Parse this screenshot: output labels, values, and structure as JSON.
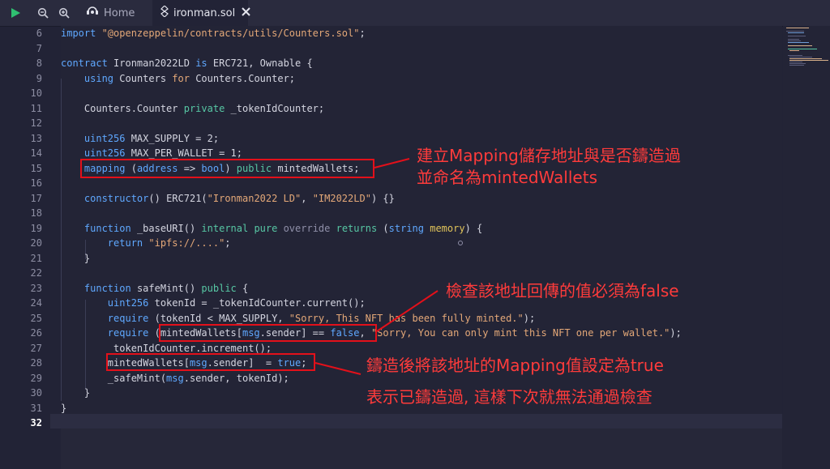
{
  "toolbar": {
    "run_icon": "play-icon",
    "zoom_out_icon": "zoom-out-icon",
    "zoom_in_icon": "zoom-in-icon",
    "tabs": [
      {
        "label": "Home",
        "icon": "remix-logo-icon"
      },
      {
        "label": "ironman.sol",
        "icon": "solidity-file-icon"
      }
    ]
  },
  "editor": {
    "file": "ironman.sol",
    "current_line": "32",
    "lines": [
      {
        "n": "6",
        "text": "import \"@openzeppelin/contracts/utils/Counters.sol\";"
      },
      {
        "n": "7",
        "text": ""
      },
      {
        "n": "8",
        "text": "contract Ironman2022LD is ERC721, Ownable {"
      },
      {
        "n": "9",
        "text": "    using Counters for Counters.Counter;"
      },
      {
        "n": "10",
        "text": ""
      },
      {
        "n": "11",
        "text": "    Counters.Counter private _tokenIdCounter;"
      },
      {
        "n": "12",
        "text": ""
      },
      {
        "n": "13",
        "text": "    uint256 MAX_SUPPLY = 2;"
      },
      {
        "n": "14",
        "text": "    uint256 MAX_PER_WALLET = 1;"
      },
      {
        "n": "15",
        "text": "    mapping (address => bool) public mintedWallets;"
      },
      {
        "n": "16",
        "text": ""
      },
      {
        "n": "17",
        "text": "    constructor() ERC721(\"Ironman2022 LD\", \"IM2022LD\") {}"
      },
      {
        "n": "18",
        "text": ""
      },
      {
        "n": "19",
        "text": "    function _baseURI() internal pure override returns (string memory) {"
      },
      {
        "n": "20",
        "text": "        return \"ipfs://....\";"
      },
      {
        "n": "21",
        "text": "    }"
      },
      {
        "n": "22",
        "text": ""
      },
      {
        "n": "23",
        "text": "    function safeMint() public {"
      },
      {
        "n": "24",
        "text": "        uint256 tokenId = _tokenIdCounter.current();"
      },
      {
        "n": "25",
        "text": "        require (tokenId < MAX_SUPPLY, \"Sorry, This NFT has been fully minted.\");"
      },
      {
        "n": "26",
        "text": "        require (mintedWallets[msg.sender] == false, \"Sorry, You can only mint this NFT one per wallet.\");"
      },
      {
        "n": "27",
        "text": "        _tokenIdCounter.increment();"
      },
      {
        "n": "28",
        "text": "        mintedWallets[msg.sender]  = true;"
      },
      {
        "n": "29",
        "text": "        _safeMint(msg.sender, tokenId);"
      },
      {
        "n": "30",
        "text": "    }"
      },
      {
        "n": "31",
        "text": "}"
      },
      {
        "n": "32",
        "text": ""
      }
    ]
  },
  "annotations": {
    "mapping_note_line1": "建立Mapping儲存地址與是否鑄造過",
    "mapping_note_line2": "並命名為mintedWallets",
    "require_note": "檢查該地址回傳的值必須為false",
    "set_true_note_line1": "鑄造後將該地址的Mapping值設定為true",
    "set_true_note_line2": "表示已鑄造過, 這樣下次就無法通過檢查",
    "color": "#ff3b3b"
  },
  "colors": {
    "keyword": "#5fa8ff",
    "string": "#e4a878",
    "green_keyword": "#57c7a4",
    "memory_keyword": "#e0c35a",
    "box_border": "#e3101a",
    "background": "#222336"
  }
}
